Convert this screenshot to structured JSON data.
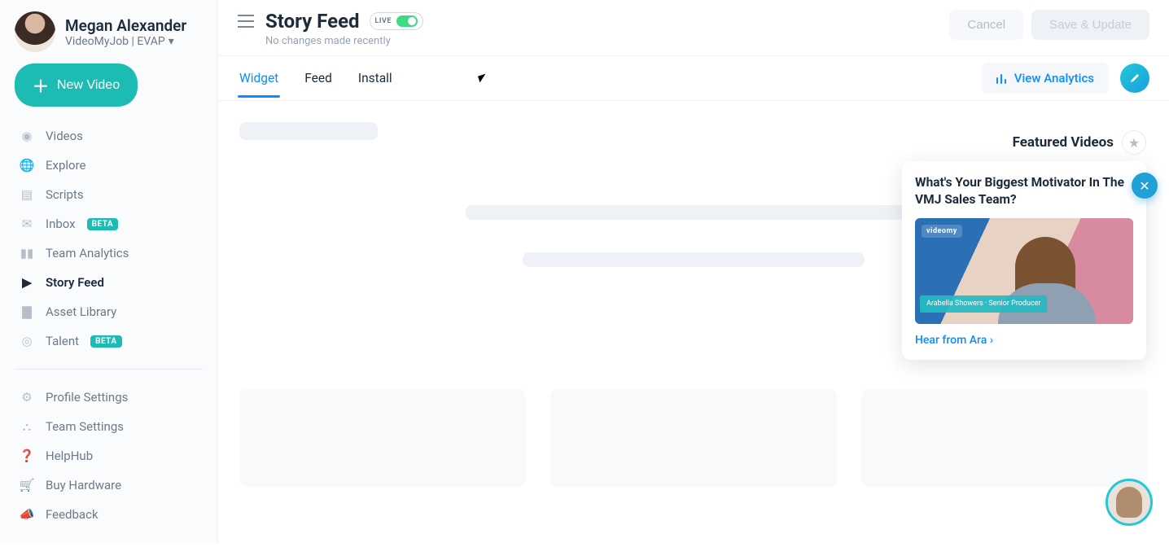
{
  "user": {
    "name": "Megan Alexander",
    "org": "VideoMyJob | EVAP"
  },
  "sidebar": {
    "newVideo": "New Video",
    "items": [
      {
        "icon": "eye-icon",
        "label": "Videos",
        "badge": null,
        "active": false
      },
      {
        "icon": "globe-icon",
        "label": "Explore",
        "badge": null,
        "active": false
      },
      {
        "icon": "script-icon",
        "label": "Scripts",
        "badge": null,
        "active": false
      },
      {
        "icon": "mail-icon",
        "label": "Inbox",
        "badge": "BETA",
        "active": false
      },
      {
        "icon": "chart-icon",
        "label": "Team Analytics",
        "badge": null,
        "active": false
      },
      {
        "icon": "feed-icon",
        "label": "Story Feed",
        "badge": null,
        "active": true
      },
      {
        "icon": "folder-icon",
        "label": "Asset Library",
        "badge": null,
        "active": false
      },
      {
        "icon": "target-icon",
        "label": "Talent",
        "badge": "BETA",
        "active": false
      }
    ],
    "footer": [
      {
        "icon": "gear-icon",
        "label": "Profile Settings"
      },
      {
        "icon": "people-icon",
        "label": "Team Settings"
      },
      {
        "icon": "help-icon",
        "label": "HelpHub"
      },
      {
        "icon": "cart-icon",
        "label": "Buy Hardware"
      },
      {
        "icon": "megaphone-icon",
        "label": "Feedback"
      }
    ]
  },
  "header": {
    "title": "Story Feed",
    "liveLabel": "LIVE",
    "subtitle": "No changes made recently",
    "cancel": "Cancel",
    "save": "Save & Update"
  },
  "tabs": {
    "items": [
      "Widget",
      "Feed",
      "Install"
    ],
    "activeIndex": 0,
    "viewAnalytics": "View Analytics"
  },
  "featured": {
    "sectionTitle": "Featured Videos",
    "cardTitle": "What's Your Biggest Motivator In The VMJ Sales Team?",
    "brandTag": "videomy",
    "lowerThird": "Arabella Showers · Senior Producer",
    "link": "Hear from Ara"
  },
  "colors": {
    "accent": "#1CBBB4",
    "link": "#0a8dff"
  }
}
